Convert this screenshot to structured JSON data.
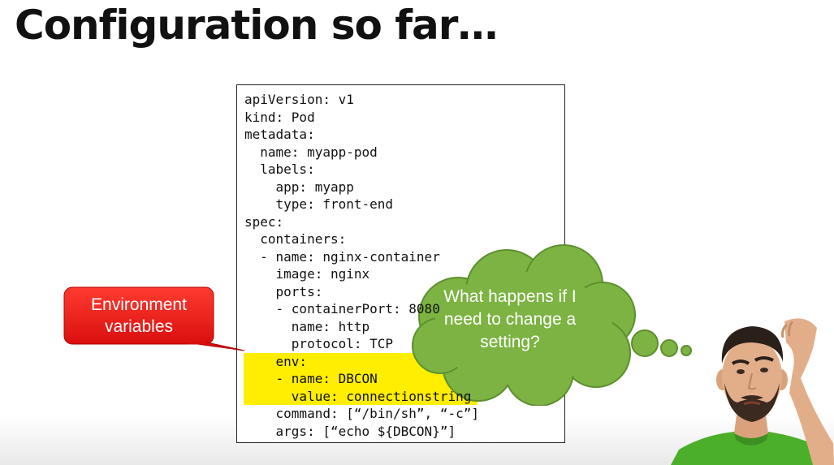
{
  "slide": {
    "title": "Configuration so far…"
  },
  "code": {
    "lines": [
      "apiVersion: v1",
      "kind: Pod",
      "metadata:",
      "  name: myapp-pod",
      "  labels:",
      "    app: myapp",
      "    type: front-end",
      "spec:",
      "  containers:",
      "  - name: nginx-container",
      "    image: nginx",
      "    ports:",
      "    - containerPort: 8080",
      "      name: http",
      "      protocol: TCP",
      "    env:",
      "    - name: DBCON",
      "      value: connectionstring",
      "    command: [“/bin/sh”, “-c”]",
      "    args: [“echo ${DBCON}”]"
    ],
    "highlighted_lines": [
      15,
      16,
      17
    ],
    "highlight_color": "#ffee00"
  },
  "callout": {
    "text": "Environment variables",
    "color": "#ee1c1c"
  },
  "thought": {
    "text": "What happens if I need to change a setting?",
    "color": "#7cb342"
  },
  "person": {
    "icon": "confused-man-illustration"
  }
}
